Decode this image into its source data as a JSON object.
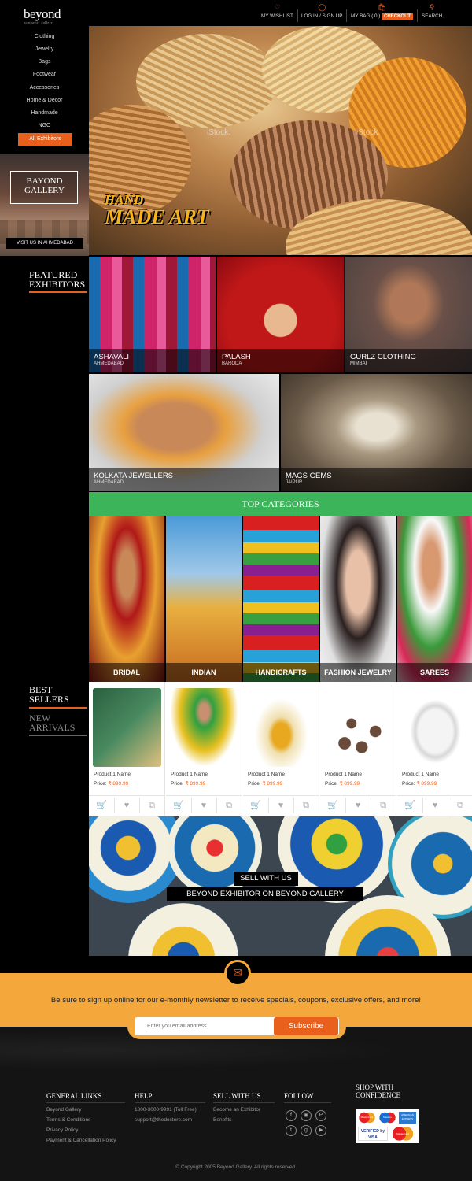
{
  "brand": {
    "name": "beyond",
    "tagline": "bombastic gallery"
  },
  "header": {
    "wishlist": "MY WISHLIST",
    "login": "LOG IN / SIGN UP",
    "bag": "MY BAG ( 0 )",
    "checkout": "CHECKOUT",
    "search": "SEARCH"
  },
  "sidebar": {
    "items": [
      "Clothing",
      "Jewelry",
      "Bags",
      "Footwear",
      "Accessories",
      "Home & Decor",
      "Handmade",
      "NGO"
    ],
    "all_exhibitors": "All Exhibitors",
    "gallery_line1": "BAYOND",
    "gallery_line2": "GALLERY",
    "visit": "VISIT US IN AHMEDABAD",
    "featured_line1": "FEATURED",
    "featured_line2": "EXHIBITORS",
    "best_line1": "BEST",
    "best_line2": "SELLERS",
    "new_line1": "NEW",
    "new_line2": "ARRIVALS"
  },
  "hero": {
    "line1": "HAND",
    "line2": "MADE ART",
    "watermark": "iStock."
  },
  "featured": [
    {
      "name": "ASHAVALI",
      "city": "AHMEDABAD"
    },
    {
      "name": "PALASH",
      "city": "BARODA"
    },
    {
      "name": "GURLZ CLOTHING",
      "city": "MIMBAI"
    },
    {
      "name": "KOLKATA JEWELLERS",
      "city": "AHMEDABAD"
    },
    {
      "name": "MAGS GEMS",
      "city": "JAIPUR"
    }
  ],
  "top_categories": {
    "title": "TOP CATEGORIES",
    "items": [
      "BRIDAL",
      "INDIAN",
      "HANDICRAFTS",
      "FASHION JEWELRY",
      "SAREES"
    ]
  },
  "products": [
    {
      "name": "Product 1 Name",
      "price_label": "Price:",
      "price": "₹ 899.99"
    },
    {
      "name": "Product 1 Name",
      "price_label": "Price:",
      "price": "₹ 899.99"
    },
    {
      "name": "Product 1 Name",
      "price_label": "Price:",
      "price": "₹ 899.99"
    },
    {
      "name": "Product 1 Name",
      "price_label": "Price:",
      "price": "₹ 899.99"
    },
    {
      "name": "Product 1 Name",
      "price_label": "Price:",
      "price": "₹ 899.99"
    }
  ],
  "sell": {
    "line1": "SELL WITH US",
    "line2": "BEYOND EXHIBITOR ON BEYOND GALLERY"
  },
  "newsletter": {
    "text": "Be sure to sign up online for our e-monthly newsletter to receive specials, coupons, exclusive offers, and more!",
    "placeholder": "Enter you email address",
    "button": "Subscribe"
  },
  "footer": {
    "general": {
      "title": "GENERAL LINKS",
      "links": [
        "Beyond Gallery",
        "Terms & Conditions",
        "Privacy Policy",
        "Payment & Cancellation Policy"
      ]
    },
    "help": {
      "title": "HELP",
      "phone": "1800-3000-9991 (Toll Free)",
      "email": "support@thedostore.com"
    },
    "sell": {
      "title": "SELL WITH US",
      "links": [
        "Become an Exhibitor",
        "Benefits"
      ]
    },
    "follow": {
      "title": "FOLLOW"
    },
    "shop": {
      "title_line1": "SHOP WITH",
      "title_line2": "CONFIDENCE",
      "cards": [
        "MasterCard",
        "Maestro",
        "AMERICAN EXPRESS",
        "VERIFIED by VISA",
        "MasterCard"
      ]
    },
    "copyright": "© Copyright 2005 Beyond Gallery. All rights reserved."
  },
  "colors": {
    "accent": "#e8601c",
    "green": "#3bb45a",
    "newsletter": "#f4a73a"
  }
}
